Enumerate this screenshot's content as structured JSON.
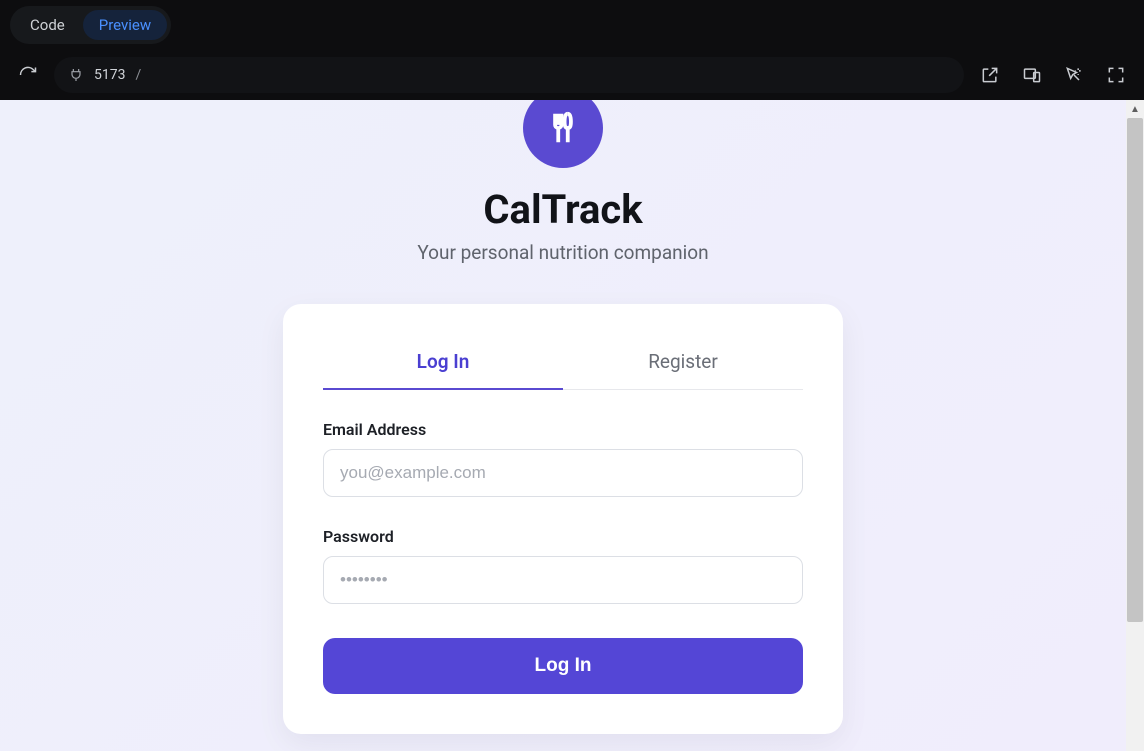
{
  "chrome": {
    "tabs": {
      "code": "Code",
      "preview": "Preview"
    },
    "url": {
      "port": "5173",
      "path": "/"
    }
  },
  "app": {
    "logo_icon": "utensils-icon",
    "title": "CalTrack",
    "subtitle": "Your personal nutrition companion",
    "auth": {
      "tabs": {
        "login": "Log In",
        "register": "Register"
      },
      "email": {
        "label": "Email Address",
        "placeholder": "you@example.com",
        "value": ""
      },
      "password": {
        "label": "Password",
        "placeholder": "••••••••",
        "value": ""
      },
      "submit_label": "Log In"
    }
  },
  "colors": {
    "accent": "#5446d6",
    "accent_text": "#4a3fd1",
    "logo_bg": "#5a4ad1"
  }
}
